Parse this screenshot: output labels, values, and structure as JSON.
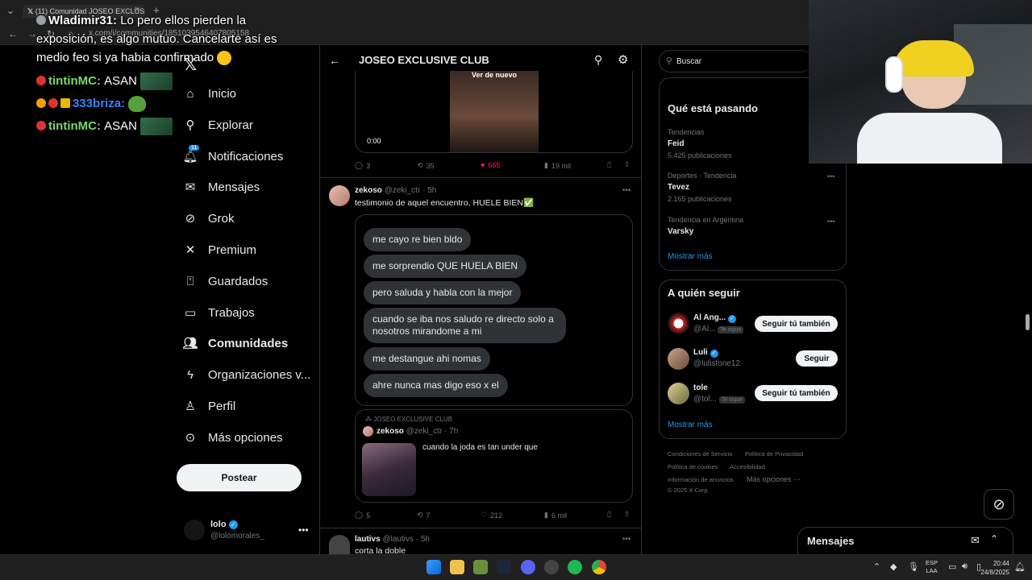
{
  "browser": {
    "tab_title": "(11) Comunidad JOSEO EXCLUSI",
    "url": "x.com/i/communities/1851039546407805158",
    "tab_close": "×",
    "new_tab": "+"
  },
  "chat": [
    {
      "user": "Wladimir31:",
      "text": "Lo pero ellos pierden la"
    },
    {
      "user": "",
      "text": "exposición, es algo mutuo. Cancelarte así es"
    },
    {
      "user": "",
      "text": "medio feo si ya habia confirmado"
    },
    {
      "user": "tintinMC:",
      "text": "ASAN"
    },
    {
      "user": "333briza:",
      "text": ""
    },
    {
      "user": "tintinMC:",
      "text": "ASAN"
    }
  ],
  "nav": {
    "items": [
      {
        "label": "Inicio",
        "icon": "home-icon"
      },
      {
        "label": "Explorar",
        "icon": "search-icon"
      },
      {
        "label": "Notificaciones",
        "icon": "bell-icon",
        "badge": "11"
      },
      {
        "label": "Mensajes",
        "icon": "mail-icon"
      },
      {
        "label": "Grok",
        "icon": "grok-icon"
      },
      {
        "label": "Premium",
        "icon": "x-icon"
      },
      {
        "label": "Guardados",
        "icon": "bookmark-icon"
      },
      {
        "label": "Trabajos",
        "icon": "briefcase-icon"
      },
      {
        "label": "Comunidades",
        "icon": "people-icon"
      },
      {
        "label": "Organizaciones v...",
        "icon": "lightning-icon"
      },
      {
        "label": "Perfil",
        "icon": "person-icon"
      },
      {
        "label": "Más opciones",
        "icon": "more-circle-icon"
      }
    ],
    "post_label": "Postear",
    "account_name": "lolo",
    "account_handle": "@lolomorales_"
  },
  "header": {
    "title": "JOSEO EXCLUSIVE CLUB"
  },
  "video_tweet": {
    "overlay": "Ver de nuevo",
    "time": "0:00",
    "replies": "3",
    "retweets": "35",
    "likes": "665",
    "views": "19 mil"
  },
  "tweet1": {
    "name": "zekoso",
    "handle": "@zeki_ctr · 5h",
    "text": "testimonio de aquel encuentro, HUELE BIEN✅",
    "bubbles": [
      "me cayo re bien bldo",
      "me sorprendio QUE HUELA BIEN",
      "pero saluda y habla con la mejor",
      "cuando se iba nos saludo re directo solo a nosotros mirandome a mi",
      "me destangue ahi nomas",
      "ahre nunca mas digo eso x el"
    ],
    "quote_community": "JOSEO EXCLUSIVE CLUB",
    "quote_name": "zekoso",
    "quote_handle": "@zeki_ctr · 7h",
    "quote_text": "cuando la joda es tan under que",
    "replies": "5",
    "retweets": "7",
    "likes": "212",
    "views": "6 mil"
  },
  "tweet2": {
    "name": "lautivs",
    "handle": "@lautivs · 5h",
    "text": "corta la doble"
  },
  "search": {
    "placeholder": "Buscar"
  },
  "trends": {
    "title": "Qué está pasando",
    "items": [
      {
        "context": "Tendencias",
        "name": "Feid",
        "count": "5.425 publicaciones"
      },
      {
        "context": "Deportes · Tendencia",
        "name": "Tevez",
        "count": "2.165 publicaciones"
      },
      {
        "context": "Tendencia en Argentina",
        "name": "Varsky",
        "count": ""
      }
    ],
    "more": "Mostrar más"
  },
  "follow": {
    "title": "A quién seguir",
    "items": [
      {
        "name": "Al Ang...",
        "handle": "@Al...",
        "tag": "Te sigue",
        "button": "Seguir tú también"
      },
      {
        "name": "Luli",
        "handle": "@lulistone12",
        "tag": "",
        "button": "Seguir"
      },
      {
        "name": "tole",
        "handle": "@tol...",
        "tag": "Te sigue",
        "button": "Seguir tú también"
      }
    ],
    "more": "Mostrar más"
  },
  "footer": {
    "links": [
      "Condiciones de Servicio",
      "Política de Privacidad",
      "Política de cookies",
      "Accesibilidad",
      "Información de anuncios",
      "Más opciones ···"
    ],
    "copyright": "© 2025 X Corp."
  },
  "messages_drawer": {
    "title": "Mensajes"
  },
  "taskbar": {
    "lang1": "ESP",
    "lang2": "LAA",
    "time": "20:44",
    "date": "24/8/2025"
  },
  "colors": {
    "like": "#f91880",
    "verified": "#1d9bf0",
    "accent": "#1d9bf0"
  }
}
